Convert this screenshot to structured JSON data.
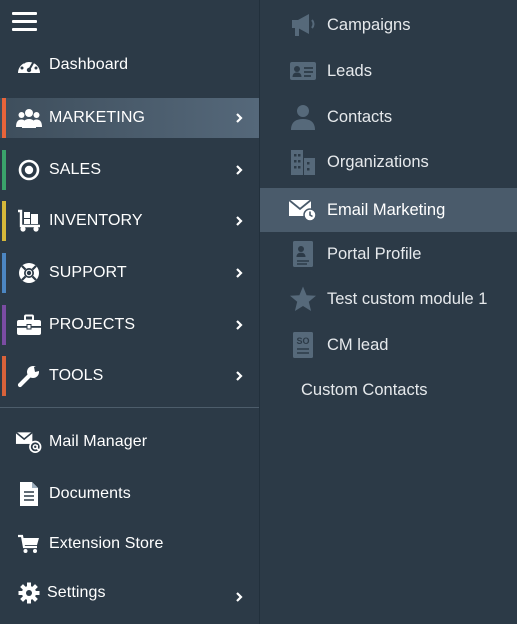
{
  "colors": {
    "background": "#2c3a47",
    "active_left": "#55687a",
    "active_right": "#4a5b6b",
    "marketing": "#e8643a",
    "sales": "#3aa36b",
    "inventory": "#d6b83a",
    "support": "#4c86c2",
    "projects": "#7b4ca3",
    "tools": "#d9623a"
  },
  "sidebar": {
    "menu_icon": "hamburger-icon",
    "items": [
      {
        "label": "Dashboard",
        "icon": "gauge-icon"
      },
      {
        "label": "MARKETING",
        "icon": "users-icon"
      },
      {
        "label": "SALES",
        "icon": "target-icon"
      },
      {
        "label": "INVENTORY",
        "icon": "dolly-icon"
      },
      {
        "label": "SUPPORT",
        "icon": "life-ring-icon"
      },
      {
        "label": "PROJECTS",
        "icon": "briefcase-icon"
      },
      {
        "label": "TOOLS",
        "icon": "wrench-icon"
      },
      {
        "label": "Mail Manager",
        "icon": "mail-at-icon"
      },
      {
        "label": "Documents",
        "icon": "document-icon"
      },
      {
        "label": "Extension Store",
        "icon": "cart-icon"
      },
      {
        "label": "Settings",
        "icon": "gear-icon"
      }
    ]
  },
  "submenu": {
    "items": [
      {
        "label": "Campaigns",
        "icon": "megaphone-icon"
      },
      {
        "label": "Leads",
        "icon": "id-card-icon"
      },
      {
        "label": "Contacts",
        "icon": "person-icon"
      },
      {
        "label": "Organizations",
        "icon": "buildings-icon"
      },
      {
        "label": "Email Marketing",
        "icon": "email-clock-icon"
      },
      {
        "label": "Portal Profile",
        "icon": "profile-doc-icon"
      },
      {
        "label": "Test custom module 1",
        "icon": "star-icon"
      },
      {
        "label": "CM lead",
        "icon": "so-doc-icon"
      },
      {
        "label": "Custom Contacts"
      }
    ]
  }
}
